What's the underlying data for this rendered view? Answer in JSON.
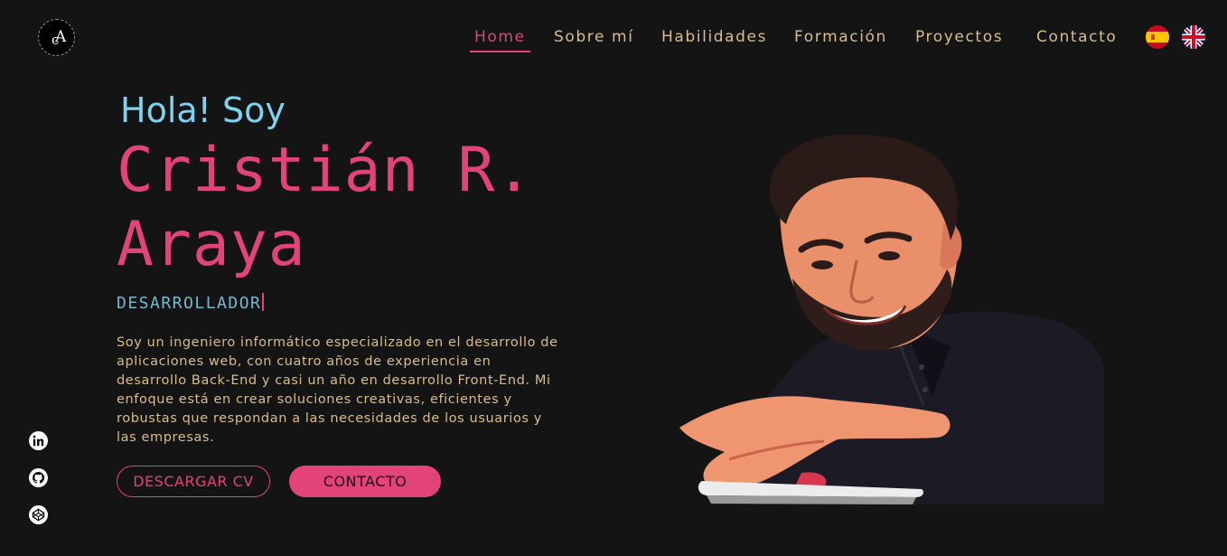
{
  "nav": {
    "items": [
      {
        "label": "Home",
        "active": true
      },
      {
        "label": "Sobre mí",
        "active": false
      },
      {
        "label": "Habilidades",
        "active": false
      },
      {
        "label": "Formación",
        "active": false
      },
      {
        "label": "Proyectos",
        "active": false
      },
      {
        "label": "Contacto",
        "active": false
      }
    ],
    "languages": [
      "spain-flag-icon",
      "uk-flag-icon"
    ]
  },
  "hero": {
    "greeting": "Hola! Soy",
    "name_line1": "Cristián R.",
    "name_line2": "Araya",
    "role": "DESARROLLADOR",
    "description": "Soy un ingeniero informático especializado en el desarrollo de aplicaciones web, con cuatro años de experiencia en desarrollo Back-End y casi un año en desarrollo Front-End. Mi enfoque está en crear soluciones creativas, eficientes y robustas que respondan a las necesidades de los usuarios y las empresas.",
    "download_cv_label": "DESCARGAR CV",
    "contact_label": "CONTACTO"
  },
  "social": [
    "linkedin-icon",
    "github-icon",
    "codepen-icon"
  ],
  "colors": {
    "background": "#141414",
    "accent_pink": "#e2447a",
    "accent_cyan": "#7fd2ef",
    "text_gold": "#d9bd8a"
  }
}
